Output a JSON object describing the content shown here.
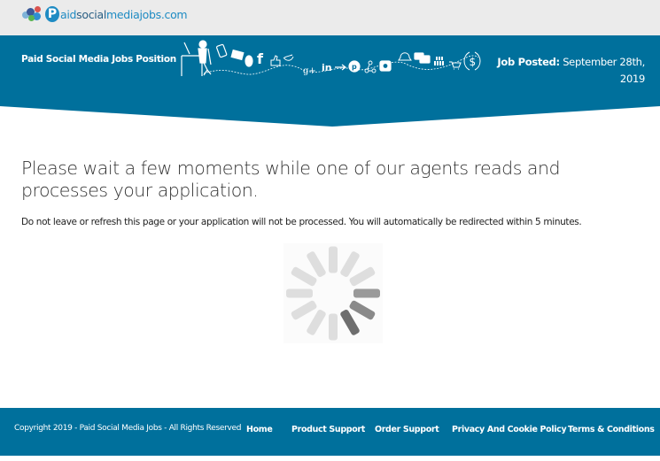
{
  "topbar": {
    "logo_text_prefix": "aid",
    "logo_text_mid": "social",
    "logo_text_suffix": "mediajobs.com",
    "logo_letter": "P"
  },
  "banner": {
    "title": "Paid Social Media Jobs Position",
    "posted_label": "Job Posted:",
    "posted_date_line1": "September 28th,",
    "posted_date_line2": "2019",
    "background_color": "#00709c",
    "icons": [
      "person-at-desk-icon",
      "smartphone-icon",
      "laptop-icon",
      "mouse-icon",
      "facebook-icon",
      "thumbs-up-icon",
      "twitter-icon",
      "google-plus-icon",
      "linkedin-icon",
      "arrow-icon",
      "pinterest-icon",
      "share-icon",
      "instagram-icon",
      "bell-icon",
      "chat-bubbles-icon",
      "people-group-icon",
      "shopping-cart-icon",
      "dollar-cycle-icon"
    ]
  },
  "main": {
    "headline": "Please wait a few moments while one of our agents reads and processes your application.",
    "subtext": "Do not leave or refresh this page or your application will not be processed. You will automatically be redirected within 5 minutes.",
    "spinner": {
      "state": "loading",
      "bars": 12
    }
  },
  "footer": {
    "copyright": "Copyright 2019 - Paid Social Media Jobs - All Rights Reserved",
    "links": [
      {
        "label": "Home"
      },
      {
        "label": "Product Support"
      },
      {
        "label": "Order Support"
      },
      {
        "label": "Privacy And Cookie Policy"
      },
      {
        "label": "Terms & Conditions"
      }
    ]
  },
  "colors": {
    "brand_blue": "#00709c",
    "logo_blue": "#1e8bc3",
    "topbar_bg": "#ebebeb"
  }
}
